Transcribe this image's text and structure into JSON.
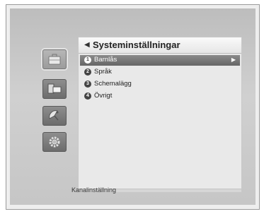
{
  "menu": {
    "title": "Systeminställningar",
    "items": [
      {
        "number": "1",
        "label": "Barnlås",
        "selected": true
      },
      {
        "number": "2",
        "label": "Språk",
        "selected": false
      },
      {
        "number": "3",
        "label": "Schemalägg",
        "selected": false
      },
      {
        "number": "4",
        "label": "Övrigt",
        "selected": false
      }
    ]
  },
  "sidebar": {
    "icons": [
      "briefcase-icon",
      "display-icon",
      "satellite-dish-icon",
      "gear-icon"
    ],
    "active": "briefcase-icon"
  },
  "footer": {
    "text": "Kanalinställning"
  }
}
